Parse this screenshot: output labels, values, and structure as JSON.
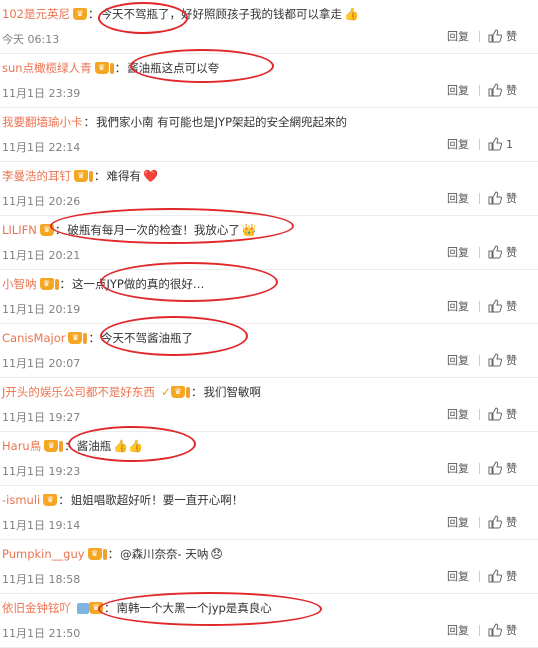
{
  "actions": {
    "reply_label": "回复",
    "like_default": "赞"
  },
  "comments": [
    {
      "username": "102是元英尼",
      "badge": "crown",
      "text": "今天不驾瓶了，好好照顾孩子我的钱都可以拿走",
      "emoji": "👍",
      "time": "今天 06:13",
      "likes": "赞",
      "ring": [
        98,
        2,
        86,
        28
      ]
    },
    {
      "username": "sun点橄榄绿人青",
      "badge": "crown-fan",
      "text": "酱油瓶这点可以夸",
      "emoji": "",
      "time": "11月1日 23:39",
      "likes": "赞",
      "ring": [
        130,
        49,
        140,
        30
      ]
    },
    {
      "username": "我要翻墙瑜小卡",
      "badge": "",
      "text": "我們家小南 有可能也是JYP架起的安全網兜起來的",
      "emoji": "",
      "time": "11月1日 22:14",
      "likes": "1",
      "ring": null
    },
    {
      "username": "李曼浩的耳钉",
      "badge": "crown-fan",
      "text": "难得有",
      "emoji": "❤️",
      "time": "11月1日 20:26",
      "likes": "赞",
      "ring": null
    },
    {
      "username": "LILIFN",
      "badge": "crown",
      "text": "破瓶有每月一次的检查！我放心了",
      "emoji": "👑",
      "time": "11月1日 20:21",
      "likes": "赞",
      "ring": [
        50,
        208,
        240,
        32
      ]
    },
    {
      "username": "小智呐",
      "badge": "crown-fan",
      "text": "这一点JYP做的真的很好…",
      "emoji": "",
      "time": "11月1日 20:19",
      "likes": "赞",
      "ring": [
        100,
        262,
        174,
        36
      ]
    },
    {
      "username": "CanisMajor",
      "badge": "crown-fan",
      "text": "今天不驾酱油瓶了",
      "emoji": "",
      "time": "11月1日 20:07",
      "likes": "赞",
      "ring": [
        100,
        316,
        144,
        36
      ]
    },
    {
      "username": "J开头的娱乐公司都不是好东西",
      "badge": "v-fan",
      "text": "我们智敏啊",
      "emoji": "",
      "time": "11月1日 19:27",
      "likes": "赞",
      "ring": null
    },
    {
      "username": "Haru鳥",
      "badge": "crown-fan",
      "text": "酱油瓶",
      "emoji": "👍👍",
      "time": "11月1日 19:23",
      "likes": "赞",
      "ring": [
        68,
        426,
        124,
        32
      ]
    },
    {
      "username": "-ismuli",
      "badge": "crown",
      "text": "姐姐唱歌超好听！要一直开心啊！",
      "emoji": "",
      "time": "11月1日 19:14",
      "likes": "赞",
      "ring": null
    },
    {
      "username": "Pumpkin__guy",
      "badge": "crown-fan",
      "text": "@森川奈奈- 天呐",
      "emoji": "😞",
      "time": "11月1日 18:58",
      "likes": "赞",
      "ring": null
    },
    {
      "username": "依旧金钟铉吖",
      "badge": "lv",
      "text": "南韩一个大黑一个jyp是真良心",
      "emoji": "",
      "time": "11月1日 21:50",
      "likes": "赞",
      "ring": [
        98,
        592,
        220,
        30
      ]
    }
  ]
}
